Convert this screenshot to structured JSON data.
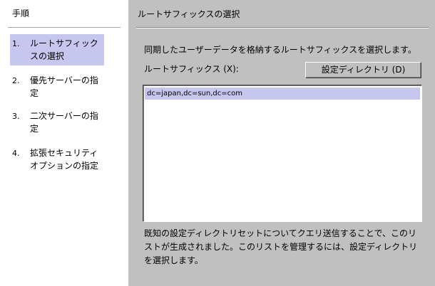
{
  "steps": {
    "title": "手順",
    "items": [
      {
        "num": "1.",
        "line1": "ルートサフィック",
        "line2": "スの選択",
        "active": true
      },
      {
        "num": "2.",
        "line1": "優先サーバーの指",
        "line2": "定",
        "active": false
      },
      {
        "num": "3.",
        "line1": "二次サーバーの指",
        "line2": "定",
        "active": false
      },
      {
        "num": "4.",
        "line1": "拡張セキュリティ",
        "line2": "オプションの指定",
        "active": false
      }
    ]
  },
  "content": {
    "title": "ルートサフィックスの選択",
    "instruction": "同期したユーザーデータを格納するルートサフィックスを選択します。",
    "suffix_label": "ルートサフィックス (X):",
    "directory_button": "設定ディレクトリ (D)",
    "suffix_list": [
      "dc=japan,dc=sun,dc=com"
    ],
    "footnote": {
      "line1": "既知の設定ディレクトリセットについてクエリ送信することで、このリ",
      "line2": "ストが生成されました。このリストを管理するには、設定ディレクトリ",
      "line3": "を選択します。"
    }
  },
  "colors": {
    "panel_bg": "#c0c0c0",
    "steps_bg": "#ffffff",
    "selection": "#c6c6ee"
  }
}
